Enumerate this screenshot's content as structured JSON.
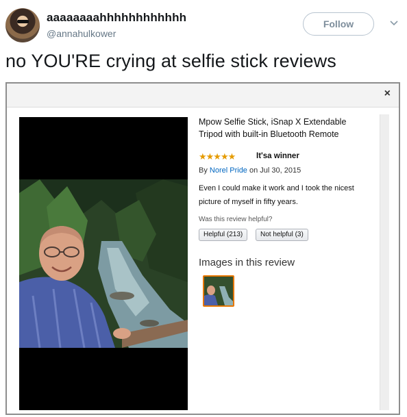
{
  "tweet": {
    "display_name": "aaaaaaaahhhhhhhhhhhh",
    "handle": "@annahulkower",
    "follow_label": "Follow",
    "text": "no YOU'RE crying at selfie stick reviews"
  },
  "review_modal": {
    "close_label": "×",
    "product_title": "Mpow Selfie Stick, iSnap X Extendable Tripod with built-in Bluetooth Remote",
    "stars": "★★★★★",
    "rating": 5,
    "headline": "It'sa winner",
    "by_prefix": "By",
    "author": "Norel Pride",
    "date": "on Jul 30, 2015",
    "body": "Even I could make it work and I took the nicest picture of myself in fifty years.",
    "helpful_question": "Was this review helpful?",
    "helpful_button": "Helpful (213)",
    "not_helpful_button": "Not helpful (3)",
    "images_heading": "Images in this review"
  },
  "colors": {
    "link": "#0066c0",
    "star": "#e59b00",
    "thumb_border": "#e77600"
  }
}
